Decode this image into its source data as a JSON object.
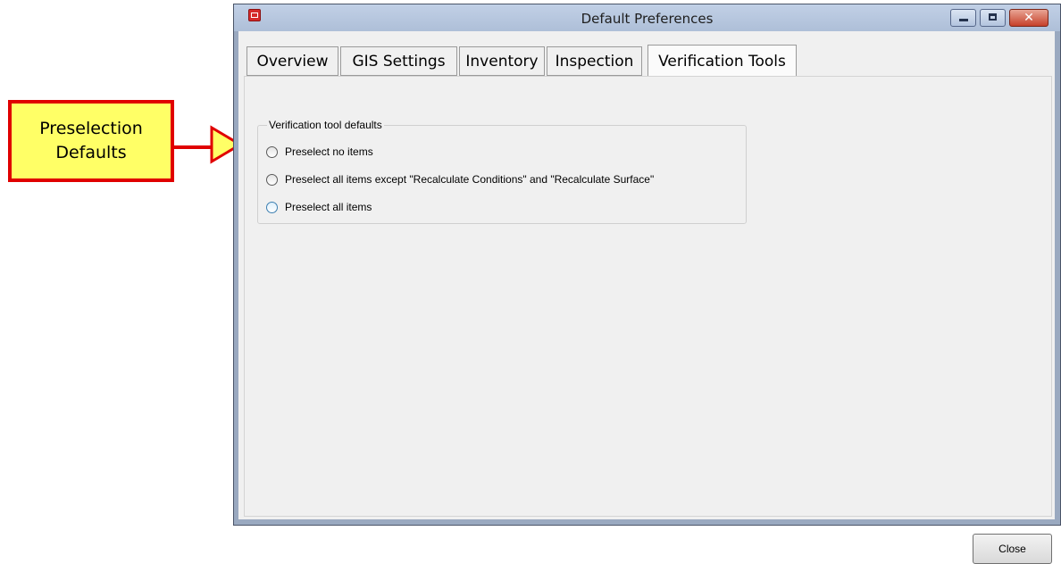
{
  "callout": {
    "line1": "Preselection",
    "line2": "Defaults",
    "fill_color": "#ffff66",
    "border_color": "#e00000"
  },
  "window": {
    "title": "Default Preferences",
    "icons": [
      "app-icon",
      "minimize-icon",
      "maximize-icon",
      "close-icon"
    ]
  },
  "tabs": [
    {
      "label": "Overview",
      "active": false
    },
    {
      "label": "GIS Settings",
      "active": false
    },
    {
      "label": "Inventory",
      "active": false
    },
    {
      "label": "Inspection",
      "active": false
    },
    {
      "label": "Verification Tools",
      "active": true
    }
  ],
  "group": {
    "legend": "Verification tool defaults",
    "options": [
      {
        "label": "Preselect no items",
        "checked": false
      },
      {
        "label": "Preselect all items except \"Recalculate Conditions\" and \"Recalculate Surface\"",
        "checked": false
      },
      {
        "label": "Preselect all items",
        "checked": false
      }
    ]
  },
  "footer": {
    "close_label": "Close"
  }
}
